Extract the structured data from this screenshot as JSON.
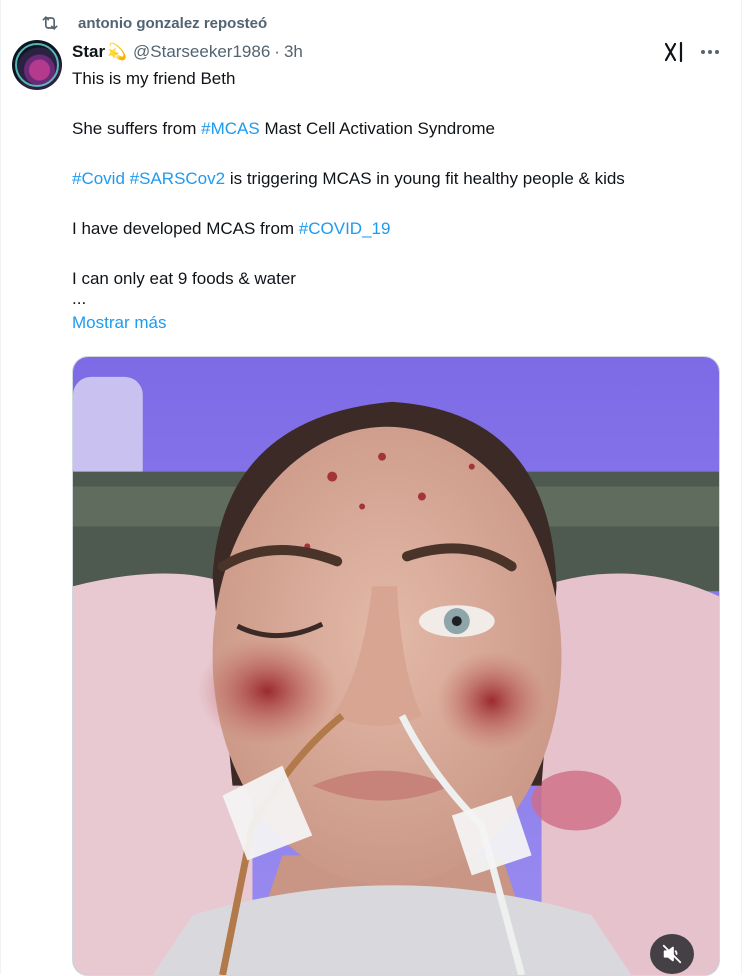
{
  "repost": {
    "icon": "repost-icon",
    "text": "antonio gonzalez reposteó"
  },
  "post": {
    "author_name": "Star",
    "author_emoji": "💫",
    "handle": "@Starseeker1986",
    "separator": "·",
    "time": "3h",
    "lines": {
      "l1": "This is my friend Beth",
      "l2_a": "She suffers from ",
      "l2_tag": "#MCAS",
      "l2_b": " Mast Cell Activation Syndrome",
      "l3_tag1": "#Covid",
      "l3_sp": " ",
      "l3_tag2": "#SARSCov2",
      "l3_b": " is triggering MCAS in young fit healthy people & kids",
      "l4_a": "I have developed MCAS from ",
      "l4_tag": "#COVID_19",
      "l5": "I can only eat 9 foods & water",
      "ellipsis": "..."
    },
    "show_more": "Mostrar más"
  },
  "icons": {
    "grok": "grok-icon",
    "more": "more-icon",
    "mute": "speaker-muted-icon"
  },
  "colors": {
    "link": "#1d9bf0",
    "secondary_text": "#536471"
  }
}
